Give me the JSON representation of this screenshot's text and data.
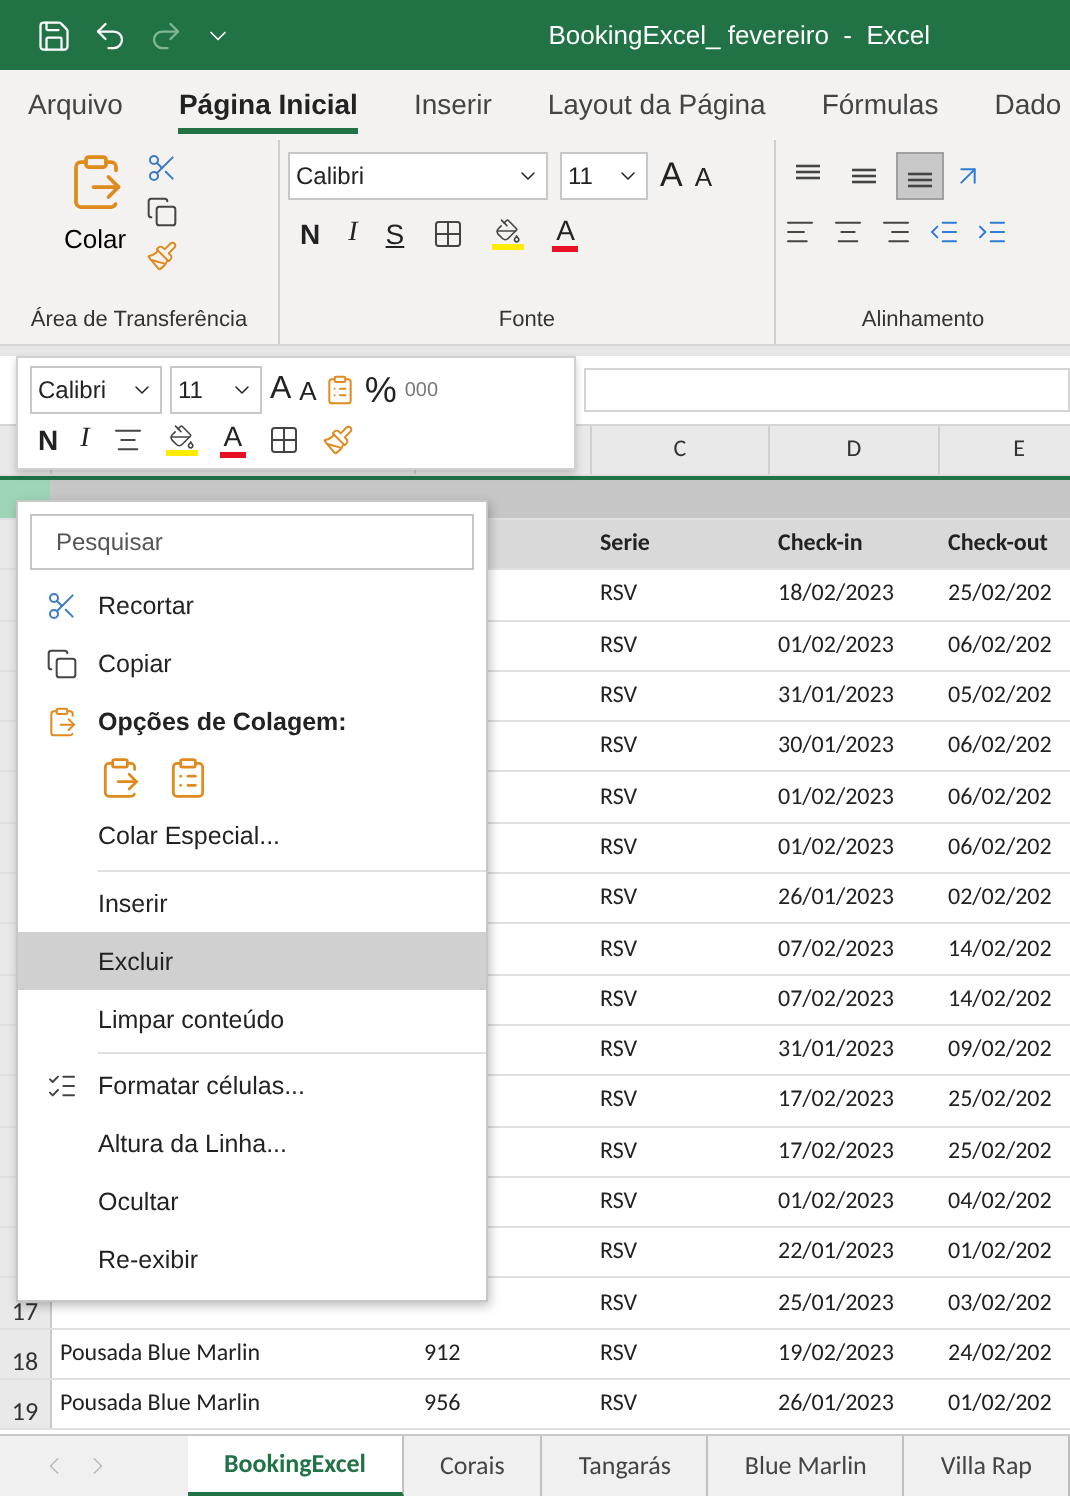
{
  "window": {
    "title": "BookingExcel_ fevereiro  -  Excel"
  },
  "ribbon_tabs": [
    {
      "label": "Arquivo",
      "selected": false
    },
    {
      "label": "Página Inicial",
      "selected": true
    },
    {
      "label": "Inserir",
      "selected": false
    },
    {
      "label": "Layout da Página",
      "selected": false
    },
    {
      "label": "Fórmulas",
      "selected": false
    },
    {
      "label": "Dado",
      "selected": false
    }
  ],
  "clipboard_group": {
    "paste_label": "Colar",
    "label": "Área de Transferência"
  },
  "font_group": {
    "font": "Calibri",
    "size": "11",
    "grow": "A",
    "shrink": "A",
    "bold": "N",
    "italic": "I",
    "underline": "S",
    "font_color_letter": "A",
    "label": "Fonte"
  },
  "alignment_group": {
    "label": "Alinhamento",
    "vertical": [
      {
        "kind": "top",
        "selected": false
      },
      {
        "kind": "middle",
        "selected": false
      },
      {
        "kind": "bottom",
        "selected": true
      }
    ]
  },
  "mini_toolbar": {
    "font": "Calibri",
    "size": "11",
    "grow": "A",
    "shrink": "A",
    "percent": "%",
    "thousands": "000",
    "bold": "N",
    "italic": "I",
    "font_color_letter": "A"
  },
  "context_menu": {
    "search": {
      "placeholder": "Pesquisar"
    },
    "items": [
      {
        "kind": "cut",
        "label": "Recortar",
        "selected": false
      },
      {
        "kind": "copy",
        "label": "Copiar",
        "selected": false
      },
      {
        "kind": "header",
        "label": "Opções de Colagem:"
      },
      {
        "kind": "paste_options"
      },
      {
        "kind": "command",
        "label": "Colar Especial...",
        "selected": false
      },
      {
        "kind": "separator"
      },
      {
        "kind": "command",
        "label": "Inserir",
        "selected": false
      },
      {
        "kind": "command",
        "label": "Excluir",
        "selected": true
      },
      {
        "kind": "command",
        "label": "Limpar conteúdo",
        "selected": false
      },
      {
        "kind": "separator"
      },
      {
        "kind": "format",
        "label": "Formatar células...",
        "selected": false
      },
      {
        "kind": "command",
        "label": "Altura da Linha...",
        "selected": false
      },
      {
        "kind": "command",
        "label": "Ocultar",
        "selected": false
      },
      {
        "kind": "command",
        "label": "Re-exibir",
        "selected": false
      }
    ]
  },
  "sheet": {
    "column_headers": [
      "C",
      "D",
      "E"
    ],
    "header_row": {
      "serie": "Serie",
      "checkin": "Check-in",
      "checkout": "Check-out"
    },
    "rows": [
      {
        "serie": "RSV",
        "checkin": "18/02/2023",
        "checkout": "25/02/202"
      },
      {
        "serie": "RSV",
        "checkin": "01/02/2023",
        "checkout": "06/02/202"
      },
      {
        "serie": "RSV",
        "checkin": "31/01/2023",
        "checkout": "05/02/202"
      },
      {
        "serie": "RSV",
        "checkin": "30/01/2023",
        "checkout": "06/02/202"
      },
      {
        "serie": "RSV",
        "checkin": "01/02/2023",
        "checkout": "06/02/202"
      },
      {
        "serie": "RSV",
        "checkin": "01/02/2023",
        "checkout": "06/02/202"
      },
      {
        "serie": "RSV",
        "checkin": "26/01/2023",
        "checkout": "02/02/202"
      },
      {
        "serie": "RSV",
        "checkin": "07/02/2023",
        "checkout": "14/02/202"
      },
      {
        "serie": "RSV",
        "checkin": "07/02/2023",
        "checkout": "14/02/202"
      },
      {
        "serie": "RSV",
        "checkin": "31/01/2023",
        "checkout": "09/02/202"
      },
      {
        "serie": "RSV",
        "checkin": "17/02/2023",
        "checkout": "25/02/202"
      },
      {
        "serie": "RSV",
        "checkin": "17/02/2023",
        "checkout": "25/02/202"
      },
      {
        "serie": "RSV",
        "checkin": "01/02/2023",
        "checkout": "04/02/202"
      },
      {
        "serie": "RSV",
        "checkin": "22/01/2023",
        "checkout": "01/02/202"
      },
      {
        "number": "17",
        "serie": "RSV",
        "checkin": "25/01/2023",
        "checkout": "03/02/202"
      },
      {
        "number": "18",
        "name": "Pousada Blue Marlin",
        "code": "912",
        "serie": "RSV",
        "checkin": "19/02/2023",
        "checkout": "24/02/202"
      },
      {
        "number": "19",
        "name": "Pousada Blue Marlin",
        "code": "956",
        "serie": "RSV",
        "checkin": "26/01/2023",
        "checkout": "01/02/202"
      }
    ]
  },
  "sheet_tabs": [
    {
      "label": "BookingExcel",
      "selected": true
    },
    {
      "label": "Corais",
      "selected": false
    },
    {
      "label": "Tangarás",
      "selected": false
    },
    {
      "label": "Blue Marlin",
      "selected": false
    },
    {
      "label": "Villa Rap",
      "selected": false
    }
  ]
}
